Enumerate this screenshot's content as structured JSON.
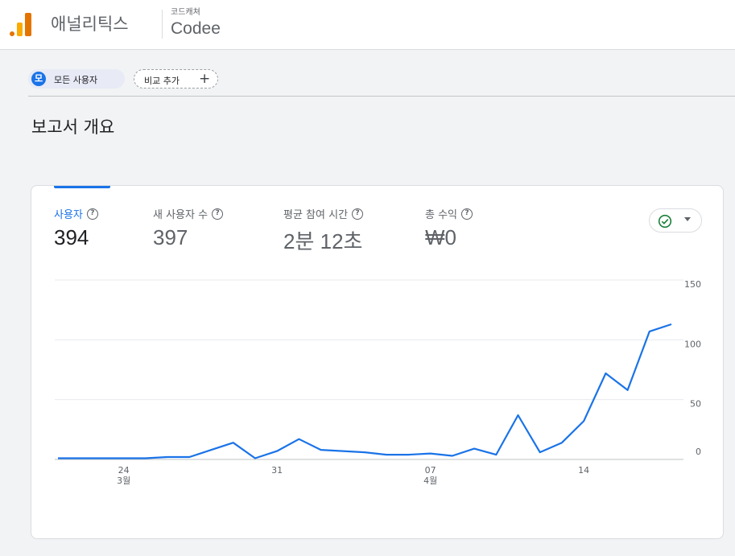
{
  "header": {
    "app_name": "애널리틱스",
    "account": "코드캐쳐",
    "property": "Codee"
  },
  "segments": {
    "all_users_badge": "모",
    "all_users_label": "모든 사용자",
    "add_compare_label": "비교 추가",
    "add_compare_icon": "plus-icon"
  },
  "page": {
    "title": "보고서 개요"
  },
  "metrics": [
    {
      "label": "사용자",
      "value": "394"
    },
    {
      "label": "새 사용자 수",
      "value": "397"
    },
    {
      "label": "평균 참여 시간",
      "value": "2분 12초"
    },
    {
      "label": "총 수익",
      "value": "₩0"
    }
  ],
  "status": {
    "icon": "check-circle-icon",
    "color": "#188038"
  },
  "chart_data": {
    "type": "line",
    "x": [
      "3/21",
      "3/22",
      "3/23",
      "3/24",
      "3/25",
      "3/26",
      "3/27",
      "3/28",
      "3/29",
      "3/30",
      "3/31",
      "4/1",
      "4/2",
      "4/3",
      "4/4",
      "4/5",
      "4/6",
      "4/7",
      "4/8",
      "4/9",
      "4/10",
      "4/11",
      "4/12",
      "4/13",
      "4/14",
      "4/15",
      "4/16",
      "4/17",
      "4/18"
    ],
    "y": [
      1,
      1,
      1,
      1,
      1,
      2,
      2,
      8,
      14,
      1,
      7,
      17,
      8,
      7,
      6,
      4,
      4,
      5,
      3,
      9,
      4,
      37,
      6,
      14,
      32,
      72,
      58,
      107,
      113
    ],
    "x_tick_labels": [
      {
        "day": "24",
        "month": "3월",
        "index": 3
      },
      {
        "day": "31",
        "month": "",
        "index": 10
      },
      {
        "day": "07",
        "month": "4월",
        "index": 17
      },
      {
        "day": "14",
        "month": "",
        "index": 24
      }
    ],
    "y_ticks": [
      "150",
      "100",
      "50",
      "0"
    ],
    "ylim": [
      0,
      150
    ],
    "line_color": "#1a73e8",
    "grid": true
  }
}
